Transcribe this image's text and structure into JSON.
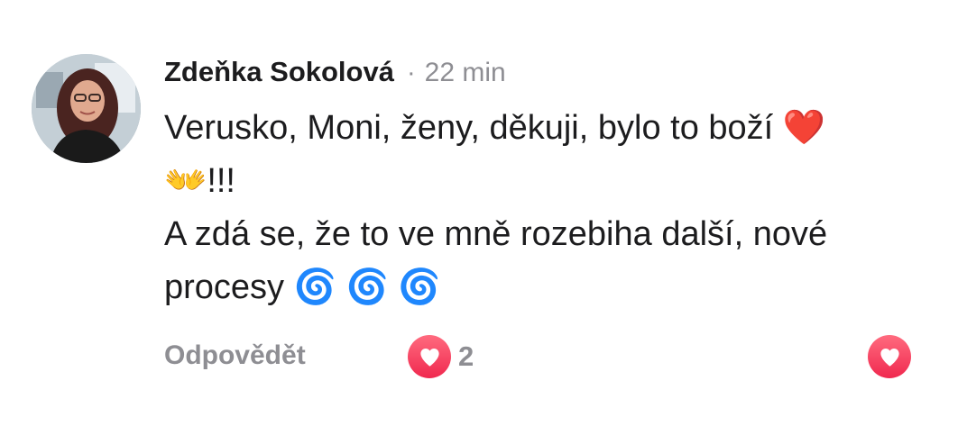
{
  "comment": {
    "author": "Zdeňka Sokolová",
    "separator": "·",
    "time": "22 min",
    "text": "Verusko, Moni, ženy, děkuji, bylo to boží ❤️\n👐!!!\nA zdá se, že to ve mně rozebiha další, nové\nprocesy 🌀 🌀 🌀"
  },
  "actions": {
    "reply_label": "Odpovědět",
    "reaction_icon": "heart-icon",
    "reaction_count": "2",
    "like_icon": "heart-icon"
  },
  "colors": {
    "heart_badge": "#f0284f",
    "secondary_text": "#8e8e93",
    "primary_text": "#1c1c1e"
  }
}
